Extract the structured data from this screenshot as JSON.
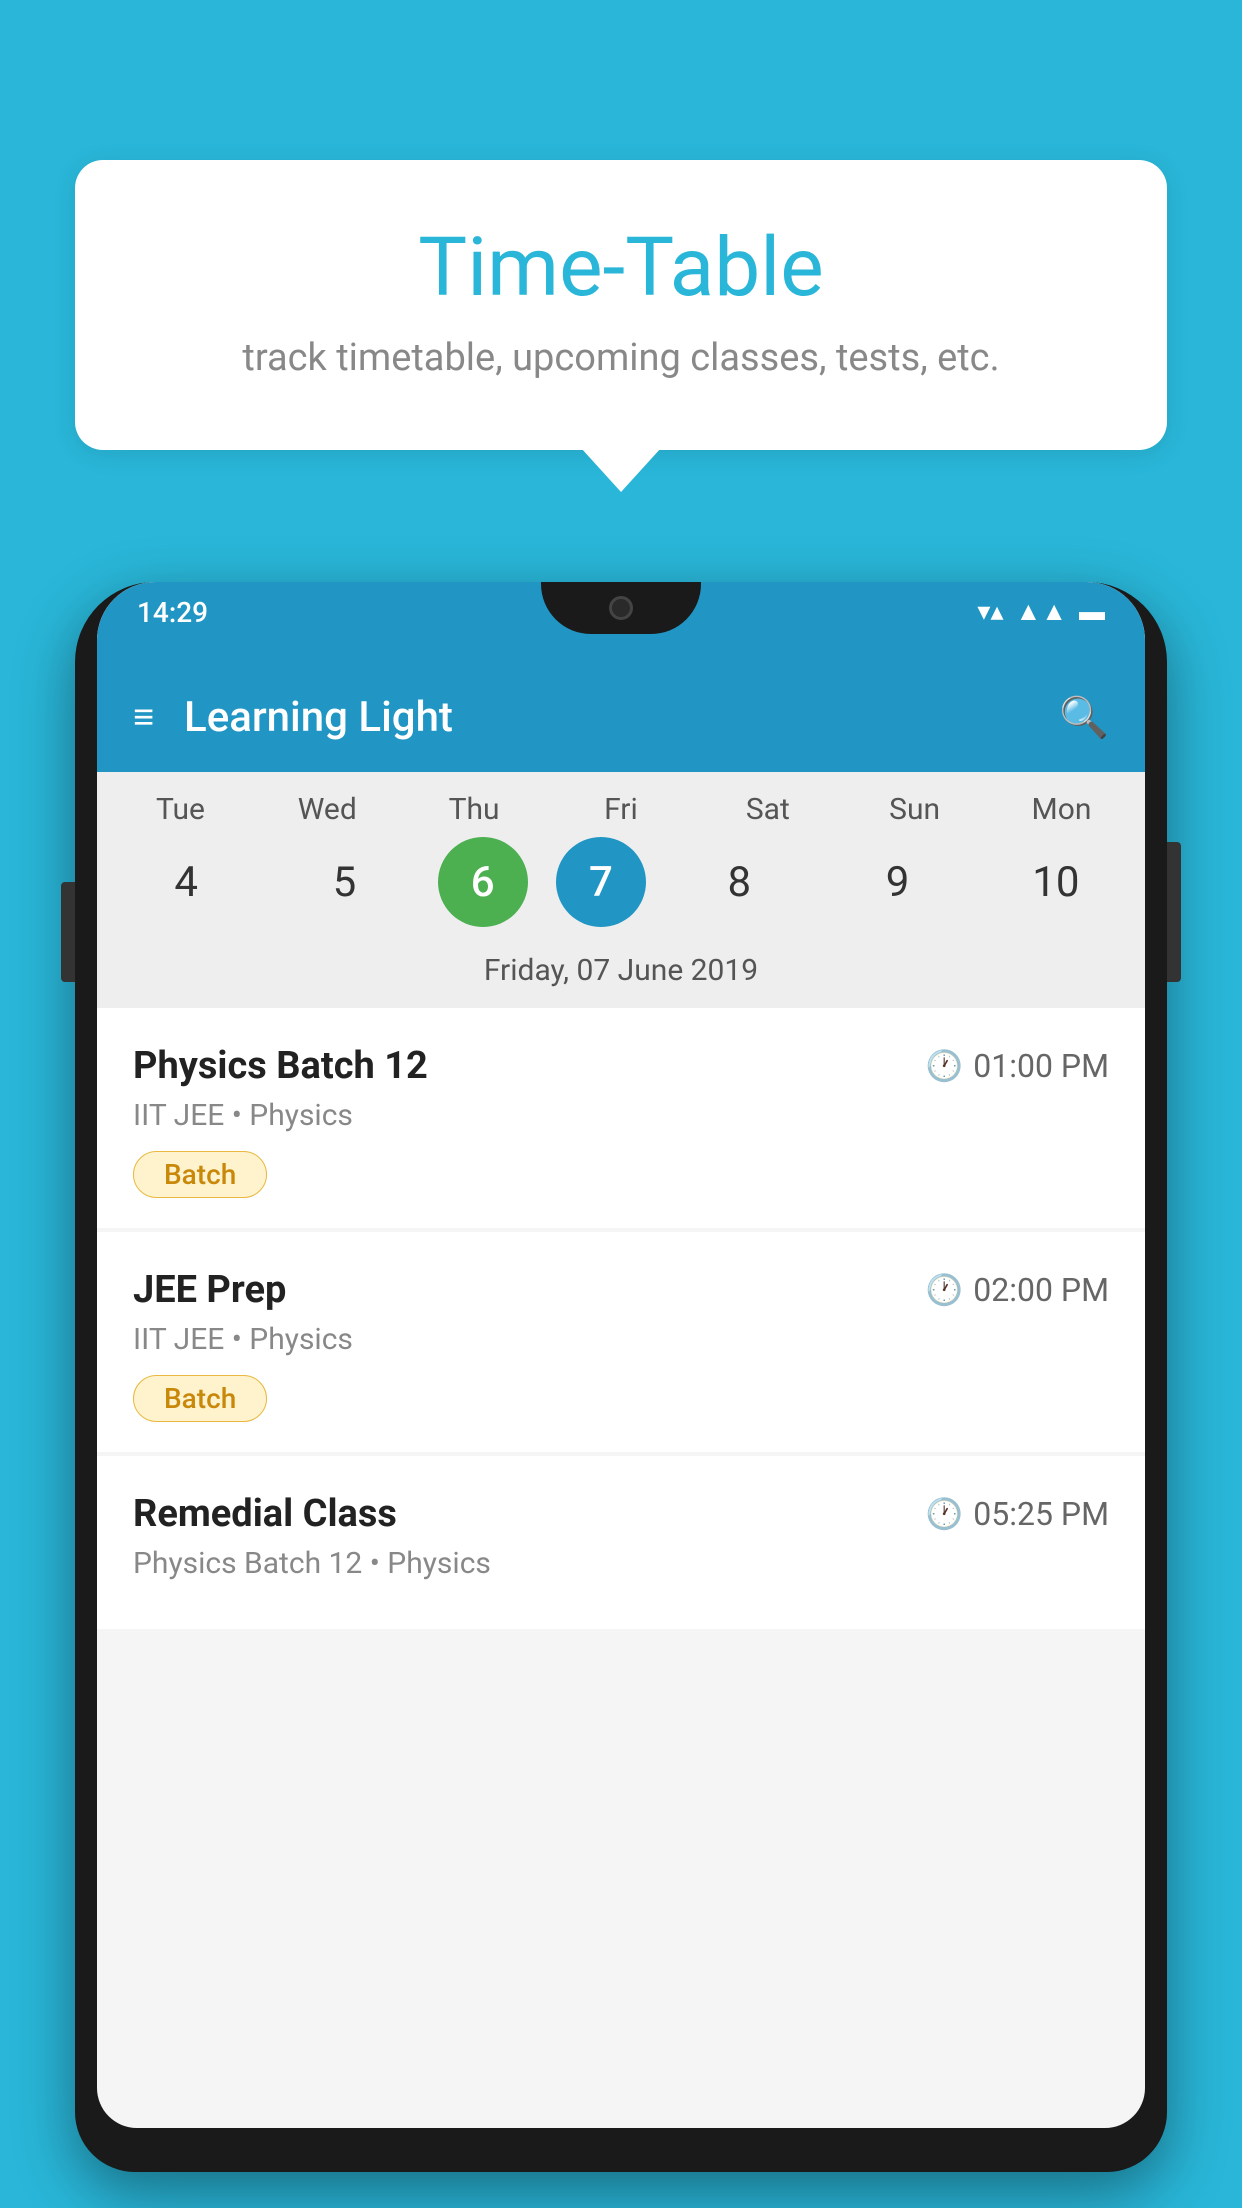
{
  "background_color": "#29b6d8",
  "bubble": {
    "title": "Time-Table",
    "subtitle": "track timetable, upcoming classes, tests, etc."
  },
  "status_bar": {
    "time": "14:29",
    "icons": [
      "wifi",
      "signal",
      "battery"
    ]
  },
  "app_bar": {
    "title": "Learning Light",
    "menu_label": "☰",
    "search_label": "🔍"
  },
  "calendar": {
    "days": [
      {
        "label": "Tue",
        "num": "4"
      },
      {
        "label": "Wed",
        "num": "5"
      },
      {
        "label": "Thu",
        "num": "6",
        "state": "today"
      },
      {
        "label": "Fri",
        "num": "7",
        "state": "selected"
      },
      {
        "label": "Sat",
        "num": "8"
      },
      {
        "label": "Sun",
        "num": "9"
      },
      {
        "label": "Mon",
        "num": "10"
      }
    ],
    "selected_date": "Friday, 07 June 2019"
  },
  "schedule": [
    {
      "name": "Physics Batch 12",
      "time": "01:00 PM",
      "meta": "IIT JEE • Physics",
      "badge": "Batch"
    },
    {
      "name": "JEE Prep",
      "time": "02:00 PM",
      "meta": "IIT JEE • Physics",
      "badge": "Batch"
    },
    {
      "name": "Remedial Class",
      "time": "05:25 PM",
      "meta": "Physics Batch 12 • Physics",
      "badge": null
    }
  ]
}
